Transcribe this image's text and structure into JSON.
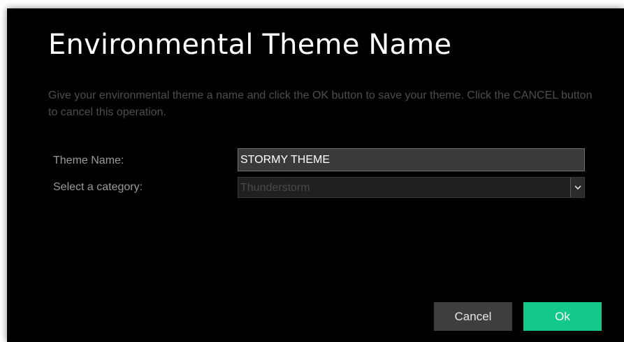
{
  "dialog": {
    "title": "Environmental Theme Name",
    "description": "Give your environmental theme a name and click the OK button to save your theme. Click the CANCEL button to cancel this operation."
  },
  "form": {
    "theme_name_label": "Theme Name:",
    "theme_name_value": "STORMY THEME",
    "category_label": "Select a category:",
    "category_value": "Thunderstorm"
  },
  "buttons": {
    "cancel_label": "Cancel",
    "ok_label": "Ok"
  },
  "icons": {
    "dropdown": "chevron-down-icon"
  },
  "colors": {
    "background": "#000000",
    "ok_button": "#13c98a",
    "cancel_button": "#3e3e3e",
    "description_text": "#4d4d4d"
  }
}
